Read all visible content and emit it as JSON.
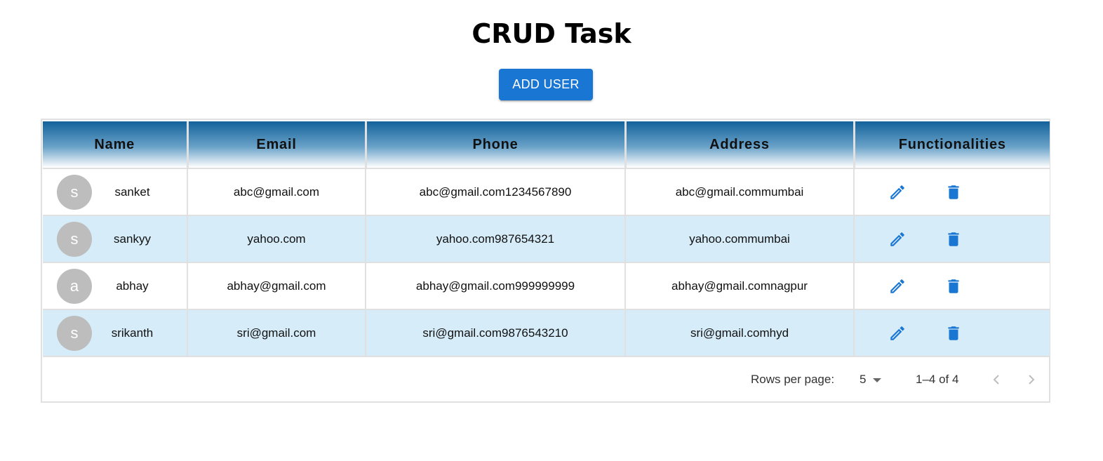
{
  "page": {
    "title": "CRUD Task"
  },
  "toolbar": {
    "add_user_label": "ADD USER"
  },
  "table": {
    "columns": [
      "Name",
      "Email",
      "Phone",
      "Address",
      "Functionalities"
    ],
    "rows": [
      {
        "initial": "s",
        "name": "sanket",
        "email": "abc@gmail.com",
        "phone": "abc@gmail.com1234567890",
        "address": "abc@gmail.commumbai"
      },
      {
        "initial": "s",
        "name": "sankyy",
        "email": "yahoo.com",
        "phone": "yahoo.com987654321",
        "address": "yahoo.commumbai"
      },
      {
        "initial": "a",
        "name": "abhay",
        "email": "abhay@gmail.com",
        "phone": "abhay@gmail.com999999999",
        "address": "abhay@gmail.comnagpur"
      },
      {
        "initial": "s",
        "name": "srikanth",
        "email": "sri@gmail.com",
        "phone": "sri@gmail.com9876543210",
        "address": "sri@gmail.comhyd"
      }
    ],
    "row_actions": [
      "pencil-icon",
      "trash-icon"
    ]
  },
  "pagination": {
    "rows_per_page_label": "Rows per page:",
    "rows_per_page_value": "5",
    "range_text": "1–4 of 4",
    "prev_icon": "chevron-left-icon",
    "next_icon": "chevron-right-icon"
  },
  "colors": {
    "accent": "#1976d2",
    "header_gradient_top": "#13629b",
    "row_alt_background": "#d6ecf9",
    "avatar_background": "#bdbdbd"
  }
}
